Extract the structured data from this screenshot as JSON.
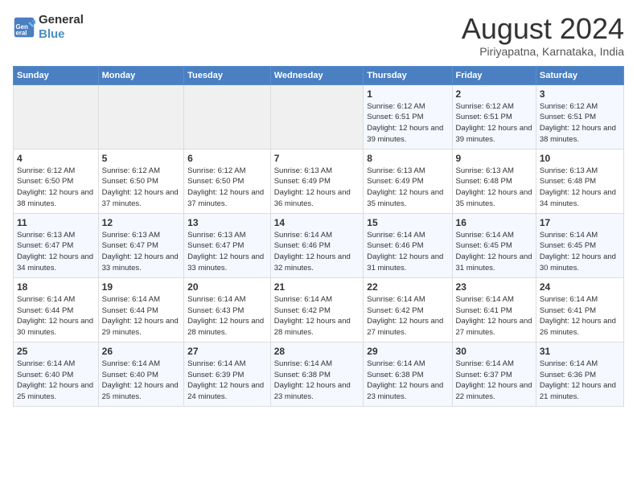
{
  "logo": {
    "line1": "General",
    "line2": "Blue"
  },
  "title": "August 2024",
  "subtitle": "Piriyapatna, Karnataka, India",
  "days_of_week": [
    "Sunday",
    "Monday",
    "Tuesday",
    "Wednesday",
    "Thursday",
    "Friday",
    "Saturday"
  ],
  "weeks": [
    [
      {
        "day": "",
        "info": ""
      },
      {
        "day": "",
        "info": ""
      },
      {
        "day": "",
        "info": ""
      },
      {
        "day": "",
        "info": ""
      },
      {
        "day": "1",
        "info": "Sunrise: 6:12 AM\nSunset: 6:51 PM\nDaylight: 12 hours and 39 minutes."
      },
      {
        "day": "2",
        "info": "Sunrise: 6:12 AM\nSunset: 6:51 PM\nDaylight: 12 hours and 39 minutes."
      },
      {
        "day": "3",
        "info": "Sunrise: 6:12 AM\nSunset: 6:51 PM\nDaylight: 12 hours and 38 minutes."
      }
    ],
    [
      {
        "day": "4",
        "info": "Sunrise: 6:12 AM\nSunset: 6:50 PM\nDaylight: 12 hours and 38 minutes."
      },
      {
        "day": "5",
        "info": "Sunrise: 6:12 AM\nSunset: 6:50 PM\nDaylight: 12 hours and 37 minutes."
      },
      {
        "day": "6",
        "info": "Sunrise: 6:12 AM\nSunset: 6:50 PM\nDaylight: 12 hours and 37 minutes."
      },
      {
        "day": "7",
        "info": "Sunrise: 6:13 AM\nSunset: 6:49 PM\nDaylight: 12 hours and 36 minutes."
      },
      {
        "day": "8",
        "info": "Sunrise: 6:13 AM\nSunset: 6:49 PM\nDaylight: 12 hours and 35 minutes."
      },
      {
        "day": "9",
        "info": "Sunrise: 6:13 AM\nSunset: 6:48 PM\nDaylight: 12 hours and 35 minutes."
      },
      {
        "day": "10",
        "info": "Sunrise: 6:13 AM\nSunset: 6:48 PM\nDaylight: 12 hours and 34 minutes."
      }
    ],
    [
      {
        "day": "11",
        "info": "Sunrise: 6:13 AM\nSunset: 6:47 PM\nDaylight: 12 hours and 34 minutes."
      },
      {
        "day": "12",
        "info": "Sunrise: 6:13 AM\nSunset: 6:47 PM\nDaylight: 12 hours and 33 minutes."
      },
      {
        "day": "13",
        "info": "Sunrise: 6:13 AM\nSunset: 6:47 PM\nDaylight: 12 hours and 33 minutes."
      },
      {
        "day": "14",
        "info": "Sunrise: 6:14 AM\nSunset: 6:46 PM\nDaylight: 12 hours and 32 minutes."
      },
      {
        "day": "15",
        "info": "Sunrise: 6:14 AM\nSunset: 6:46 PM\nDaylight: 12 hours and 31 minutes."
      },
      {
        "day": "16",
        "info": "Sunrise: 6:14 AM\nSunset: 6:45 PM\nDaylight: 12 hours and 31 minutes."
      },
      {
        "day": "17",
        "info": "Sunrise: 6:14 AM\nSunset: 6:45 PM\nDaylight: 12 hours and 30 minutes."
      }
    ],
    [
      {
        "day": "18",
        "info": "Sunrise: 6:14 AM\nSunset: 6:44 PM\nDaylight: 12 hours and 30 minutes."
      },
      {
        "day": "19",
        "info": "Sunrise: 6:14 AM\nSunset: 6:44 PM\nDaylight: 12 hours and 29 minutes."
      },
      {
        "day": "20",
        "info": "Sunrise: 6:14 AM\nSunset: 6:43 PM\nDaylight: 12 hours and 28 minutes."
      },
      {
        "day": "21",
        "info": "Sunrise: 6:14 AM\nSunset: 6:42 PM\nDaylight: 12 hours and 28 minutes."
      },
      {
        "day": "22",
        "info": "Sunrise: 6:14 AM\nSunset: 6:42 PM\nDaylight: 12 hours and 27 minutes."
      },
      {
        "day": "23",
        "info": "Sunrise: 6:14 AM\nSunset: 6:41 PM\nDaylight: 12 hours and 27 minutes."
      },
      {
        "day": "24",
        "info": "Sunrise: 6:14 AM\nSunset: 6:41 PM\nDaylight: 12 hours and 26 minutes."
      }
    ],
    [
      {
        "day": "25",
        "info": "Sunrise: 6:14 AM\nSunset: 6:40 PM\nDaylight: 12 hours and 25 minutes."
      },
      {
        "day": "26",
        "info": "Sunrise: 6:14 AM\nSunset: 6:40 PM\nDaylight: 12 hours and 25 minutes."
      },
      {
        "day": "27",
        "info": "Sunrise: 6:14 AM\nSunset: 6:39 PM\nDaylight: 12 hours and 24 minutes."
      },
      {
        "day": "28",
        "info": "Sunrise: 6:14 AM\nSunset: 6:38 PM\nDaylight: 12 hours and 23 minutes."
      },
      {
        "day": "29",
        "info": "Sunrise: 6:14 AM\nSunset: 6:38 PM\nDaylight: 12 hours and 23 minutes."
      },
      {
        "day": "30",
        "info": "Sunrise: 6:14 AM\nSunset: 6:37 PM\nDaylight: 12 hours and 22 minutes."
      },
      {
        "day": "31",
        "info": "Sunrise: 6:14 AM\nSunset: 6:36 PM\nDaylight: 12 hours and 21 minutes."
      }
    ]
  ]
}
